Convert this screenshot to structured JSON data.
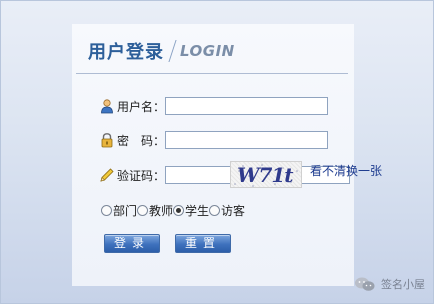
{
  "header": {
    "title_zh": "用户登录",
    "title_en": "LOGIN"
  },
  "form": {
    "username": {
      "label": "用户名：",
      "value": "",
      "icon": "user-icon"
    },
    "password": {
      "label": "密　码：",
      "value": "",
      "icon": "lock-icon"
    },
    "captcha": {
      "label": "验证码：",
      "value": "",
      "icon": "pencil-icon",
      "image_text": "W71t",
      "refresh_label": "看不清换一张"
    }
  },
  "roles": {
    "options": [
      "部门",
      "教师",
      "学生",
      "访客"
    ],
    "selected": "学生"
  },
  "buttons": {
    "login": "登录",
    "reset": "重置"
  },
  "watermark": {
    "text": "签名小屋",
    "logo": "wechat-logo"
  },
  "colors": {
    "accent": "#2d5f9a",
    "button": "#3e71bd",
    "link": "#1d3b8f"
  }
}
